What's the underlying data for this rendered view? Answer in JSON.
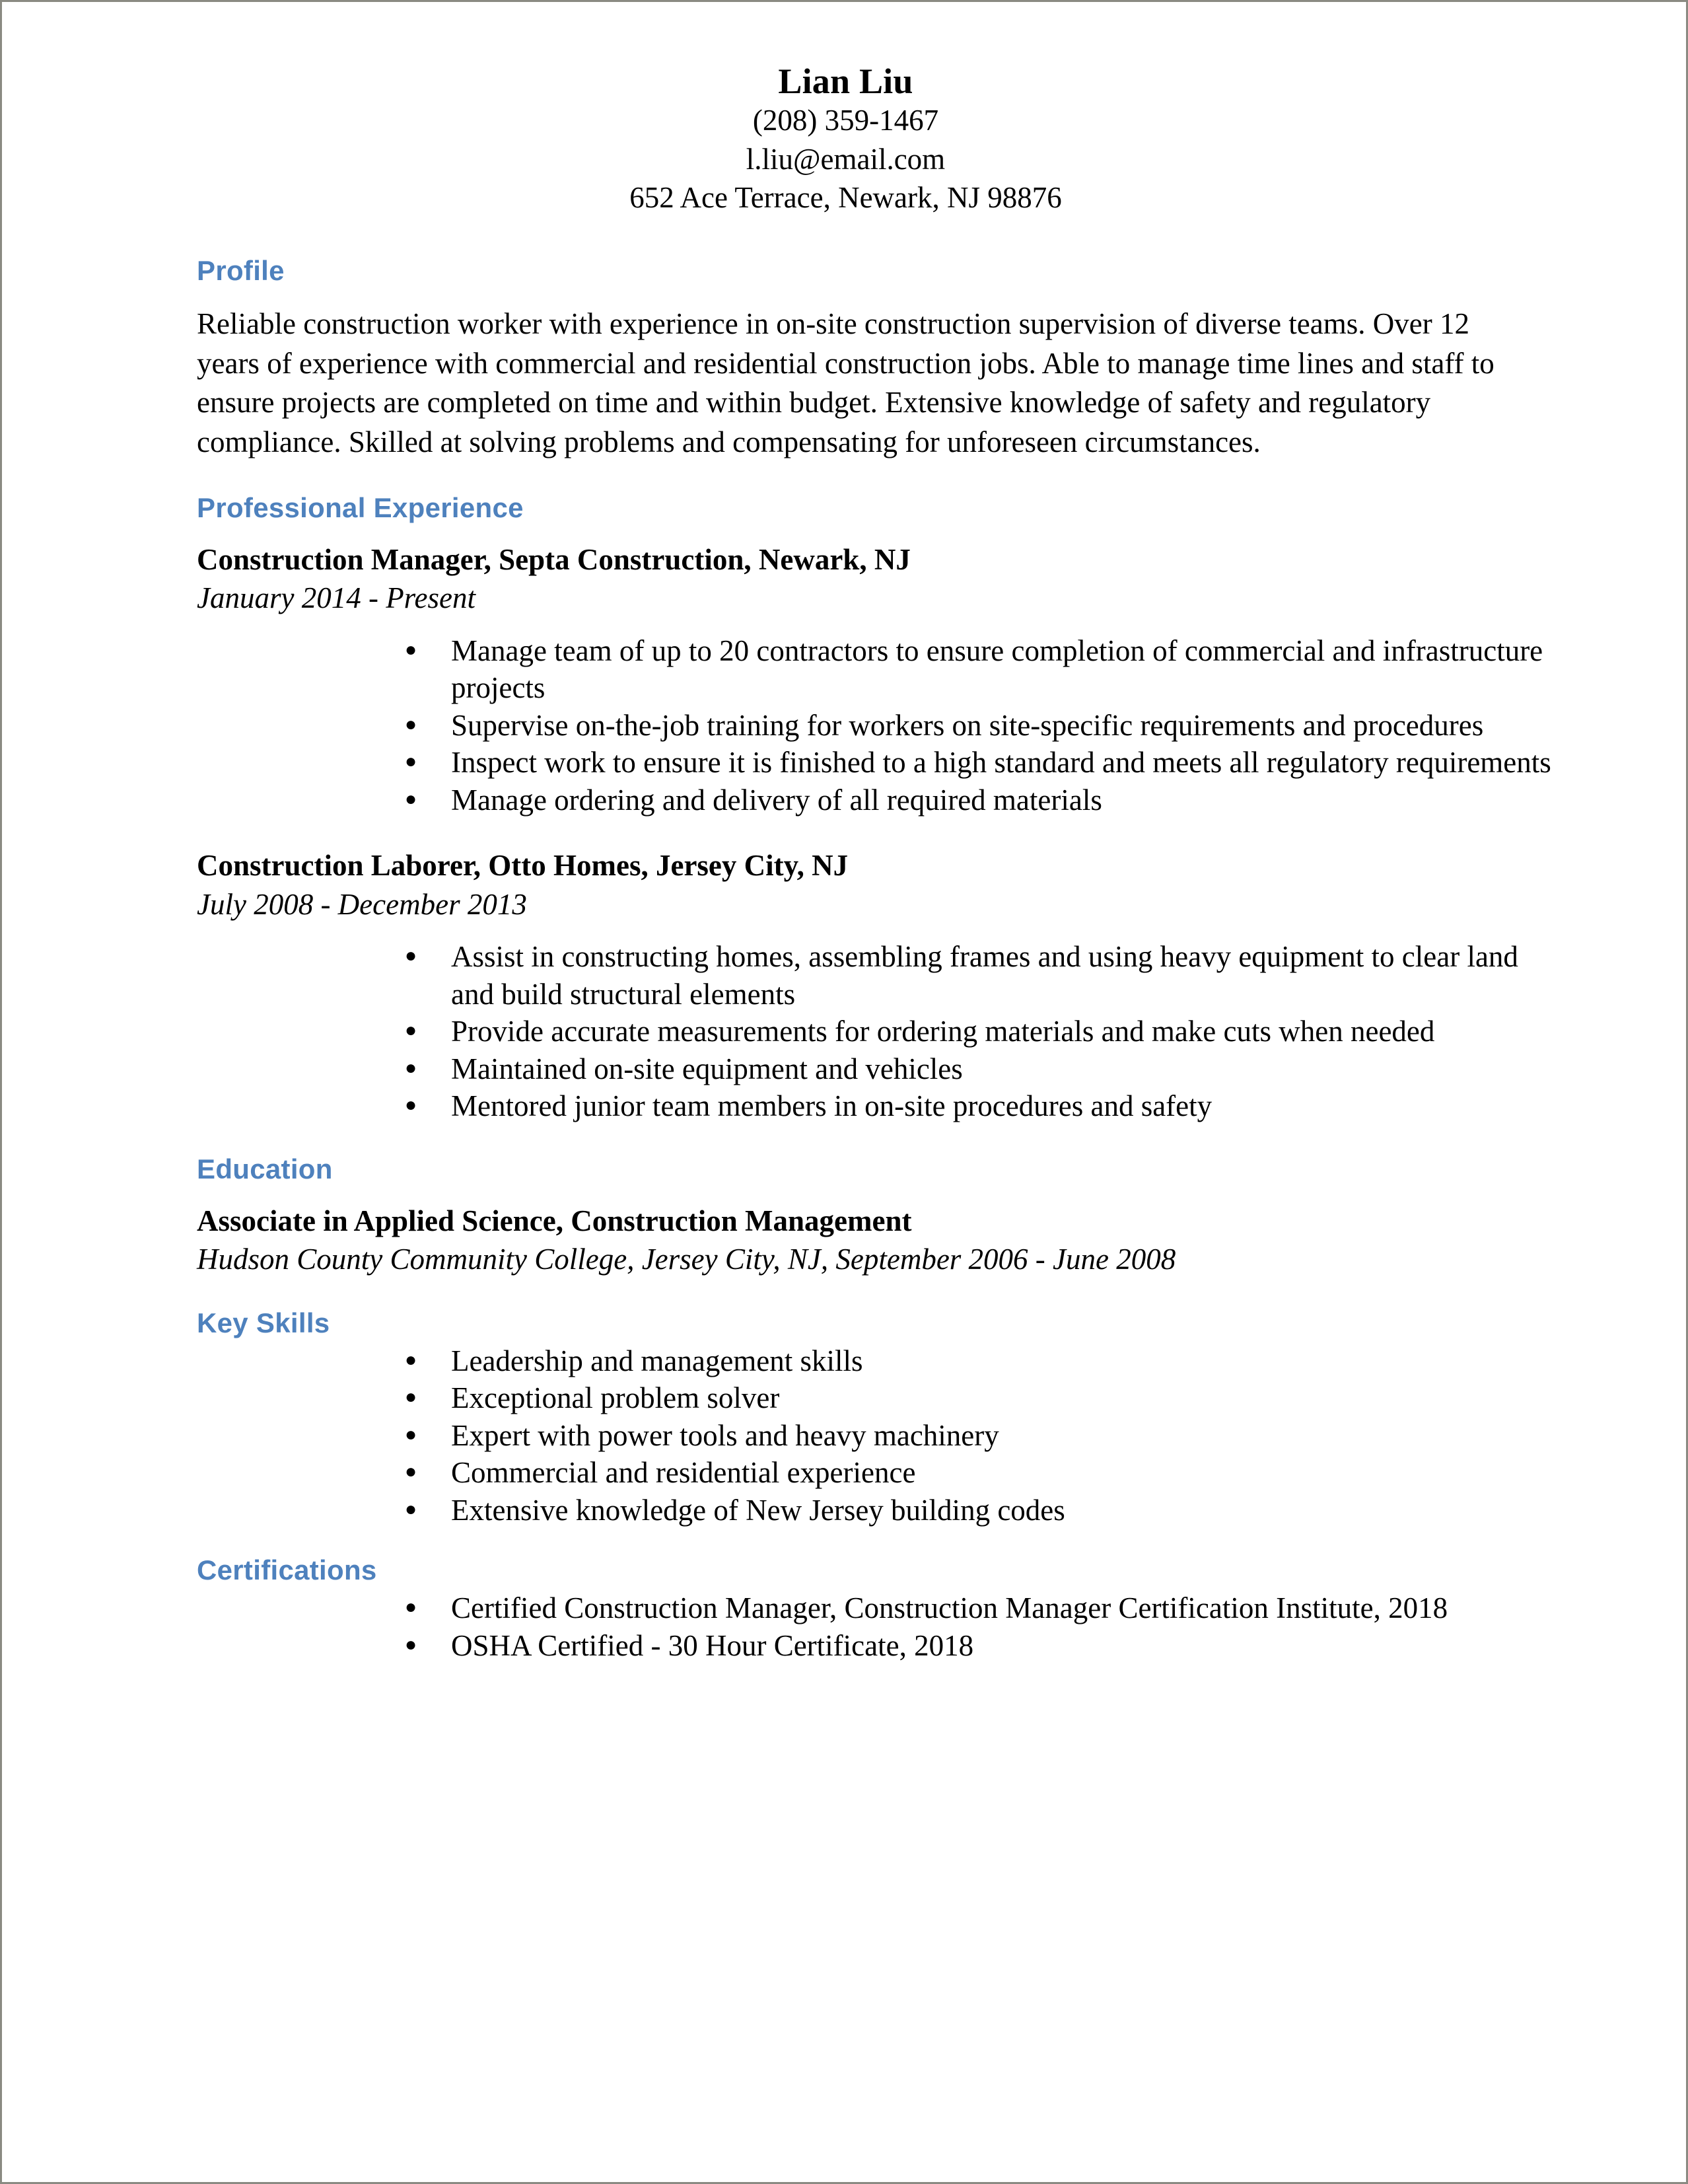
{
  "document": {
    "type": "resume",
    "accent_color": "#4e81bd",
    "text_color": "#000000",
    "background_color": "#ffffff",
    "border_color": "#8a8a82"
  },
  "header": {
    "name": "Lian Liu",
    "phone": "(208) 359-1467",
    "email": "l.liu@email.com",
    "address": "652 Ace Terrace, Newark, NJ 98876"
  },
  "profile": {
    "heading": "Profile",
    "text": "Reliable construction worker with experience in on-site construction supervision of diverse teams. Over 12 years of experience with commercial and residential construction jobs. Able to manage time lines and staff to ensure projects are completed on time and within budget. Extensive knowledge of safety and regulatory compliance. Skilled at solving problems and compensating for unforeseen circumstances."
  },
  "experience": {
    "heading": "Professional Experience",
    "jobs": [
      {
        "title": "Construction Manager, Septa Construction, Newark, NJ",
        "dates": "January 2014 - Present",
        "bullets": [
          "Manage team of up to 20 contractors to ensure completion of commercial and infrastructure projects",
          "Supervise on-the-job training for workers on site-specific requirements and procedures",
          "Inspect work to ensure it is finished to a high standard and meets all regulatory requirements",
          "Manage ordering and delivery of all required materials"
        ]
      },
      {
        "title": "Construction Laborer, Otto Homes, Jersey City, NJ",
        "dates": "July 2008 - December 2013",
        "bullets": [
          "Assist in constructing homes, assembling frames and using heavy equipment to clear land and build structural elements",
          "Provide accurate measurements for ordering materials and make cuts when needed",
          "Maintained on-site equipment and vehicles",
          "Mentored junior team members in on-site procedures and safety"
        ]
      }
    ]
  },
  "education": {
    "heading": "Education",
    "degree": "Associate in Applied Science, Construction Management",
    "school": "Hudson County Community College, Jersey City, NJ, September 2006 - June 2008"
  },
  "key_skills": {
    "heading": "Key Skills",
    "items": [
      "Leadership and management skills",
      "Exceptional problem solver",
      "Expert with power tools and heavy machinery",
      "Commercial and residential experience",
      "Extensive knowledge of New Jersey building codes"
    ]
  },
  "certifications": {
    "heading": "Certifications",
    "items": [
      "Certified Construction Manager, Construction Manager Certification Institute, 2018",
      "OSHA Certified - 30 Hour Certificate, 2018"
    ]
  }
}
